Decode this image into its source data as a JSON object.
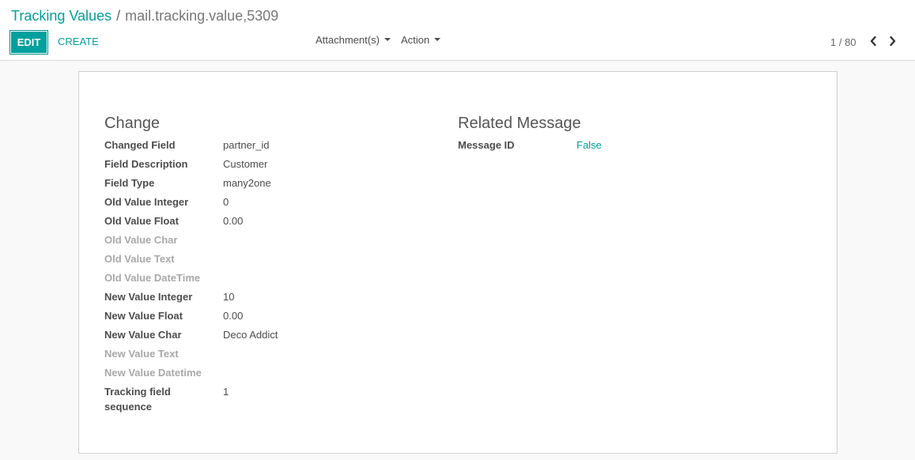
{
  "breadcrumb": {
    "parent": "Tracking Values",
    "separator": "/",
    "current": "mail.tracking.value,5309"
  },
  "toolbar": {
    "edit_label": "EDIT",
    "create_label": "CREATE",
    "attachments_label": "Attachment(s)",
    "action_label": "Action"
  },
  "pager": {
    "value": "1 / 80"
  },
  "change_group": {
    "title": "Change",
    "fields": [
      {
        "label": "Changed Field",
        "value": "partner_id"
      },
      {
        "label": "Field Description",
        "value": "Customer"
      },
      {
        "label": "Field Type",
        "value": "many2one"
      },
      {
        "label": "Old Value Integer",
        "value": "0"
      },
      {
        "label": "Old Value Float",
        "value": "0.00"
      },
      {
        "label": "Old Value Char",
        "value": ""
      },
      {
        "label": "Old Value Text",
        "value": ""
      },
      {
        "label": "Old Value DateTime",
        "value": ""
      },
      {
        "label": "New Value Integer",
        "value": "10"
      },
      {
        "label": "New Value Float",
        "value": "0.00"
      },
      {
        "label": "New Value Char",
        "value": "Deco Addict"
      },
      {
        "label": "New Value Text",
        "value": ""
      },
      {
        "label": "New Value Datetime",
        "value": ""
      },
      {
        "label": "Tracking field sequence",
        "value": "1"
      }
    ]
  },
  "related_group": {
    "title": "Related Message",
    "fields": [
      {
        "label": "Message ID",
        "value": "False"
      }
    ]
  },
  "colors": {
    "accent": "#00a09d",
    "muted_label": "#a8a8a8"
  }
}
